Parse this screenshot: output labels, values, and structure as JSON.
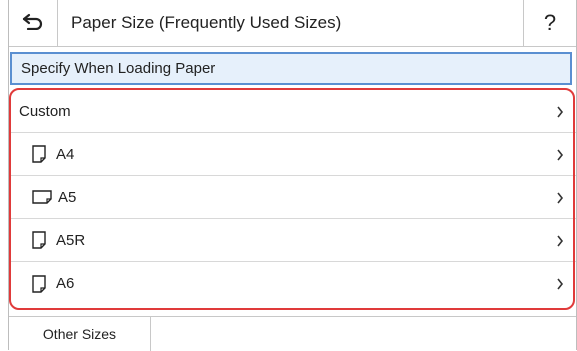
{
  "header": {
    "title": "Paper Size (Frequently Used Sizes)",
    "help_label": "?",
    "back_icon": "back-arrow-icon"
  },
  "specify": {
    "label": "Specify When Loading Paper"
  },
  "list": {
    "items": [
      {
        "label": "Custom",
        "icon": null
      },
      {
        "label": "A4",
        "icon": "portrait-paper-icon"
      },
      {
        "label": "A5",
        "icon": "landscape-paper-icon"
      },
      {
        "label": "A5R",
        "icon": "portrait-paper-icon"
      },
      {
        "label": "A6",
        "icon": "portrait-paper-icon"
      }
    ]
  },
  "footer": {
    "other_sizes_label": "Other Sizes"
  },
  "colors": {
    "highlight": "#e03a3a",
    "selected_bg": "#e6f0fb",
    "selected_border": "#5a8fd1"
  }
}
